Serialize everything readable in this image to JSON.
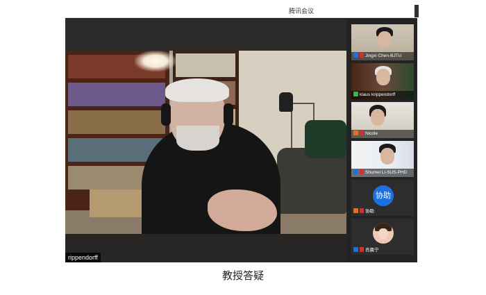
{
  "window": {
    "title": "腾讯会议"
  },
  "main_video": {
    "speaker_name": "rippendorff"
  },
  "participants": [
    {
      "name": "Jingxi Chen-BJTU",
      "badge_color": "#1e6fe0",
      "mic": "muted"
    },
    {
      "name": "klaus krippendorff",
      "badge_color": "#3bb34a",
      "mic": "active"
    },
    {
      "name": "Nicole",
      "badge_color": "#e0731e",
      "mic": "muted"
    },
    {
      "name": "Shumei Li-SUS-PHD",
      "badge_color": "#1e6fe0",
      "mic": "muted"
    },
    {
      "name": "协助",
      "avatar_text": "协助",
      "avatar_color": "#1e6fe0",
      "badge_color": "#e0731e",
      "mic": "muted"
    },
    {
      "name": "肖晨宁",
      "badge_color": "#1e6fe0",
      "mic": "muted"
    }
  ],
  "caption": "教授答疑"
}
